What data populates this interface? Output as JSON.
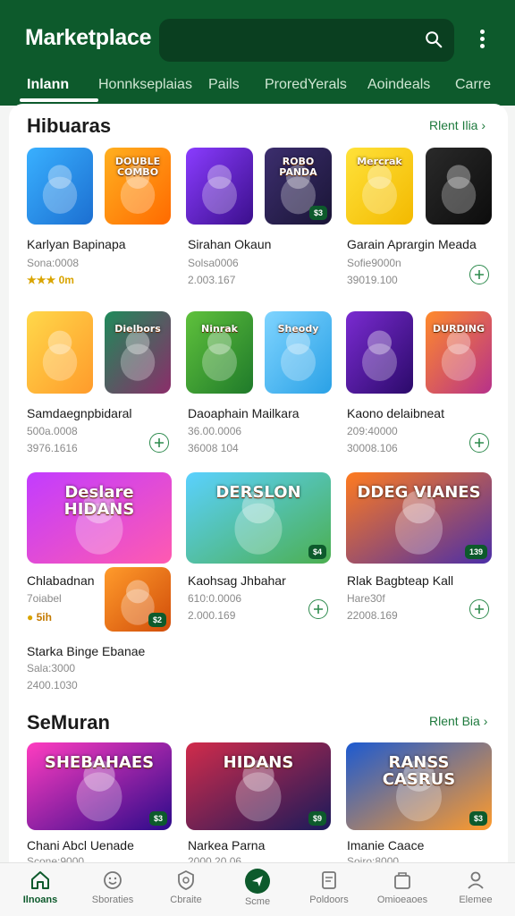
{
  "app": {
    "title": "Marketplace"
  },
  "tabs": [
    "Inlann",
    "Honnkseplaias",
    "Pails",
    "ProredYerals",
    "Aoindeals",
    "Carre"
  ],
  "sections": [
    {
      "title": "Hibuaras",
      "see_all": "Rlent Ilia"
    },
    {
      "title": "SeMuran",
      "see_all": "Rlent Bia"
    }
  ],
  "cards": [
    {
      "name": "Karlyan Bapinapa",
      "line1": "Sona:0008",
      "rating": "★★★ 0m",
      "line2": ""
    },
    {
      "name": "Sirahan Okaun",
      "line1": "Solsa0006",
      "line2": "2.003.167"
    },
    {
      "name": "Garain Aprargin Meada",
      "line1": "Sofie9000n",
      "line2": "39019.100"
    },
    {
      "name": "Samdaegnpbidaral",
      "line1": "500a.0008",
      "line2": "3976.1616"
    },
    {
      "name": "Daoaphain Mailkara",
      "line1": "36.00.0006",
      "line2": "36008 104"
    },
    {
      "name": "Kaono delaibneat",
      "line1": "209:40000",
      "line2": "30008.106"
    },
    {
      "name": "Chlabadnan",
      "line1": "7oiabel",
      "rating": "5ih"
    },
    {
      "name": "Kaohsag Jhbahar",
      "line1": "610:0.0006",
      "line2": "2.000.169"
    },
    {
      "name": "Rlak Bagbteap Kall",
      "line1": "Hare30f",
      "line2": "22008.169"
    },
    {
      "name": "Starka Binge Ebanae",
      "line1": "Sala:3000",
      "line2": "2400.1030"
    },
    {
      "name": "Chani Abcl Uenade",
      "line1": "Scone:9000",
      "line2": ""
    },
    {
      "name": "Narkea Parna",
      "line1": "2000.20.06",
      "line2": ""
    },
    {
      "name": "Imanie Caace",
      "line1": "Soiro:8000",
      "line2": ""
    }
  ],
  "thumbs": [
    {
      "text": "",
      "c1": "#39b0ff",
      "c2": "#1c6fd1",
      "tag": ""
    },
    {
      "text": "DOUBLE COMBO",
      "c1": "#ffb020",
      "c2": "#ff6a00",
      "tag": ""
    },
    {
      "text": "",
      "c1": "#8a3cff",
      "c2": "#3b0f8c",
      "tag": ""
    },
    {
      "text": "ROBO PANDA",
      "c1": "#3c2e6e",
      "c2": "#1a1536",
      "tag": "$3"
    },
    {
      "text": "Mercrak",
      "c1": "#ffe23a",
      "c2": "#f3b900",
      "tag": ""
    },
    {
      "text": "",
      "c1": "#2a2a2a",
      "c2": "#0c0c0c",
      "tag": ""
    },
    {
      "text": "",
      "c1": "#ffd84a",
      "c2": "#ff9b2b",
      "tag": ""
    },
    {
      "text": "Dielbors",
      "c1": "#1f8a5a",
      "c2": "#8b2d6a",
      "tag": ""
    },
    {
      "text": "Ninrak",
      "c1": "#5fc13c",
      "c2": "#1f7a2a",
      "tag": ""
    },
    {
      "text": "Sheody",
      "c1": "#7fd4ff",
      "c2": "#2aa1e6",
      "tag": ""
    },
    {
      "text": "",
      "c1": "#7a2bd1",
      "c2": "#2b0a6a",
      "tag": ""
    },
    {
      "text": "DURDING",
      "c1": "#ff8a2b",
      "c2": "#b7318a",
      "tag": ""
    },
    {
      "text": "Deslare HIDANS",
      "c1": "#c23cff",
      "c2": "#ff5ab0",
      "tag": ""
    },
    {
      "text": "",
      "c1": "#ff9b2b",
      "c2": "#d14d0a",
      "tag": "$2"
    },
    {
      "text": "DERSLON",
      "c1": "#5ad1ff",
      "c2": "#4caf50",
      "tag": "$4"
    },
    {
      "text": "DDEG VIANES",
      "c1": "#ff7b1f",
      "c2": "#4b2ea8",
      "tag": "139"
    },
    {
      "text": "SHEBAHAES",
      "c1": "#ff3cc0",
      "c2": "#2b0a8a",
      "tag": "$3"
    },
    {
      "text": "HIDANS",
      "c1": "#d12b4b",
      "c2": "#1a1a5a",
      "tag": "$9"
    },
    {
      "text": "RANSS CASRUS",
      "c1": "#1c5ad1",
      "c2": "#ff9b2b",
      "tag": "$3"
    }
  ],
  "nav": [
    {
      "label": "Ilnoans",
      "icon": "home-icon",
      "active": true
    },
    {
      "label": "Sboraties",
      "icon": "smile-icon"
    },
    {
      "label": "Cbraite",
      "icon": "shield-icon"
    },
    {
      "label": "Scme",
      "icon": "send-icon"
    },
    {
      "label": "Poldoors",
      "icon": "document-icon"
    },
    {
      "label": "Omioeaoes",
      "icon": "package-icon"
    },
    {
      "label": "Elemee",
      "icon": "user-icon"
    }
  ],
  "colors": {
    "brand": "#0d5a2c",
    "accent": "#1e7a3d"
  }
}
